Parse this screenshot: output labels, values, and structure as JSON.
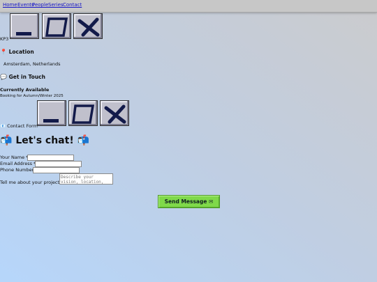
{
  "nav": {
    "links": [
      "Home",
      "Events",
      "People",
      "Series",
      "Contact"
    ]
  },
  "window_buttons": {
    "minimize": "minimize-icon",
    "maximize": "maximize-icon",
    "close": "close-icon"
  },
  "brand_label": "KP3",
  "location": {
    "icon": "📍",
    "heading": "Location",
    "value": "Amsterdam, Netherlands"
  },
  "touch": {
    "icon": "💬",
    "heading": "Get in Touch"
  },
  "availability": {
    "heading": "Currently Available",
    "detail": "Booking for Autumn/Winter 2025"
  },
  "contact_form": {
    "icon": "📧",
    "label": "Contact Form"
  },
  "chat": {
    "icon": "📬",
    "title": "Let's chat!"
  },
  "form": {
    "name_label": "Your Name *",
    "email_label": "Email Address *",
    "phone_label": "Phone Number",
    "project_label": "Tell me about your project *",
    "project_placeholder": "Describe your vision, location, any special requirements...",
    "submit_label": "Send Message ✉"
  },
  "colors": {
    "nav_link": "#1414c8",
    "submit_button": "#7fd94a",
    "window_button": "#c0c0cc",
    "window_glyph": "#121a4a"
  }
}
